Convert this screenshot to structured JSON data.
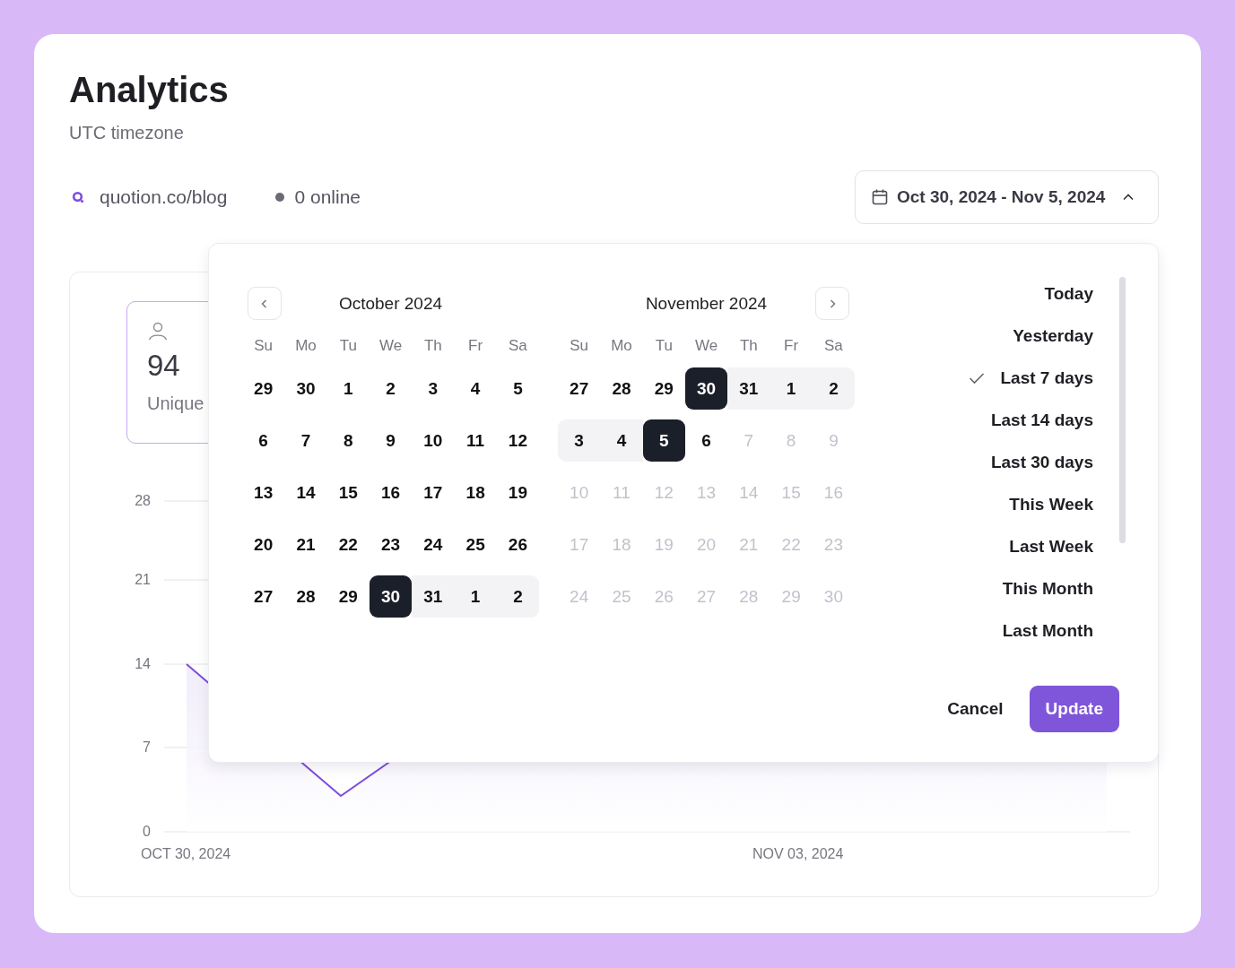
{
  "page": {
    "title": "Analytics",
    "subtitle": "UTC timezone"
  },
  "site": {
    "name": "quotion.co/blog",
    "online": "0 online"
  },
  "date_range": {
    "label": "Oct 30, 2024 - Nov 5, 2024",
    "expanded": true
  },
  "stat_card": {
    "value": "94",
    "label": "Unique"
  },
  "chart": {
    "y_ticks": [
      "28",
      "21",
      "14",
      "7",
      "0"
    ],
    "x_labels": [
      "OCT 30, 2024",
      "NOV 03, 2024"
    ]
  },
  "picker": {
    "months": [
      {
        "title": "October 2024",
        "weekdays": [
          "Su",
          "Mo",
          "Tu",
          "We",
          "Th",
          "Fr",
          "Sa"
        ],
        "weeks": [
          [
            {
              "day": "29",
              "disabled": false,
              "kind": "plain"
            },
            {
              "day": "30",
              "disabled": false,
              "kind": "plain"
            },
            {
              "day": "1",
              "disabled": false,
              "kind": "plain"
            },
            {
              "day": "2",
              "disabled": false,
              "kind": "plain"
            },
            {
              "day": "3",
              "disabled": false,
              "kind": "plain"
            },
            {
              "day": "4",
              "disabled": false,
              "kind": "plain"
            },
            {
              "day": "5",
              "disabled": false,
              "kind": "plain"
            }
          ],
          [
            {
              "day": "6",
              "disabled": false,
              "kind": "plain"
            },
            {
              "day": "7",
              "disabled": false,
              "kind": "plain"
            },
            {
              "day": "8",
              "disabled": false,
              "kind": "plain"
            },
            {
              "day": "9",
              "disabled": false,
              "kind": "plain"
            },
            {
              "day": "10",
              "disabled": false,
              "kind": "plain"
            },
            {
              "day": "11",
              "disabled": false,
              "kind": "plain"
            },
            {
              "day": "12",
              "disabled": false,
              "kind": "plain"
            }
          ],
          [
            {
              "day": "13",
              "disabled": false,
              "kind": "plain"
            },
            {
              "day": "14",
              "disabled": false,
              "kind": "plain"
            },
            {
              "day": "15",
              "disabled": false,
              "kind": "plain"
            },
            {
              "day": "16",
              "disabled": false,
              "kind": "plain"
            },
            {
              "day": "17",
              "disabled": false,
              "kind": "plain"
            },
            {
              "day": "18",
              "disabled": false,
              "kind": "plain"
            },
            {
              "day": "19",
              "disabled": false,
              "kind": "plain"
            }
          ],
          [
            {
              "day": "20",
              "disabled": false,
              "kind": "plain"
            },
            {
              "day": "21",
              "disabled": false,
              "kind": "plain"
            },
            {
              "day": "22",
              "disabled": false,
              "kind": "plain"
            },
            {
              "day": "23",
              "disabled": false,
              "kind": "plain"
            },
            {
              "day": "24",
              "disabled": false,
              "kind": "plain"
            },
            {
              "day": "25",
              "disabled": false,
              "kind": "plain"
            },
            {
              "day": "26",
              "disabled": false,
              "kind": "plain"
            }
          ],
          [
            {
              "day": "27",
              "disabled": false,
              "kind": "plain"
            },
            {
              "day": "28",
              "disabled": false,
              "kind": "plain"
            },
            {
              "day": "29",
              "disabled": false,
              "kind": "plain"
            },
            {
              "day": "30",
              "disabled": false,
              "kind": "endpoint"
            },
            {
              "day": "31",
              "disabled": false,
              "kind": "inside"
            },
            {
              "day": "1",
              "disabled": false,
              "kind": "inside"
            },
            {
              "day": "2",
              "disabled": false,
              "kind": "inside"
            }
          ]
        ]
      },
      {
        "title": "November 2024",
        "weekdays": [
          "Su",
          "Mo",
          "Tu",
          "We",
          "Th",
          "Fr",
          "Sa"
        ],
        "weeks": [
          [
            {
              "day": "27",
              "disabled": false,
              "kind": "plain"
            },
            {
              "day": "28",
              "disabled": false,
              "kind": "plain"
            },
            {
              "day": "29",
              "disabled": false,
              "kind": "plain"
            },
            {
              "day": "30",
              "disabled": false,
              "kind": "endpoint"
            },
            {
              "day": "31",
              "disabled": false,
              "kind": "inside"
            },
            {
              "day": "1",
              "disabled": false,
              "kind": "inside"
            },
            {
              "day": "2",
              "disabled": false,
              "kind": "inside"
            }
          ],
          [
            {
              "day": "3",
              "disabled": false,
              "kind": "inside"
            },
            {
              "day": "4",
              "disabled": false,
              "kind": "inside"
            },
            {
              "day": "5",
              "disabled": false,
              "kind": "endpoint"
            },
            {
              "day": "6",
              "disabled": false,
              "kind": "plain"
            },
            {
              "day": "7",
              "disabled": true,
              "kind": "plain"
            },
            {
              "day": "8",
              "disabled": true,
              "kind": "plain"
            },
            {
              "day": "9",
              "disabled": true,
              "kind": "plain"
            }
          ],
          [
            {
              "day": "10",
              "disabled": true,
              "kind": "plain"
            },
            {
              "day": "11",
              "disabled": true,
              "kind": "plain"
            },
            {
              "day": "12",
              "disabled": true,
              "kind": "plain"
            },
            {
              "day": "13",
              "disabled": true,
              "kind": "plain"
            },
            {
              "day": "14",
              "disabled": true,
              "kind": "plain"
            },
            {
              "day": "15",
              "disabled": true,
              "kind": "plain"
            },
            {
              "day": "16",
              "disabled": true,
              "kind": "plain"
            }
          ],
          [
            {
              "day": "17",
              "disabled": true,
              "kind": "plain"
            },
            {
              "day": "18",
              "disabled": true,
              "kind": "plain"
            },
            {
              "day": "19",
              "disabled": true,
              "kind": "plain"
            },
            {
              "day": "20",
              "disabled": true,
              "kind": "plain"
            },
            {
              "day": "21",
              "disabled": true,
              "kind": "plain"
            },
            {
              "day": "22",
              "disabled": true,
              "kind": "plain"
            },
            {
              "day": "23",
              "disabled": true,
              "kind": "plain"
            }
          ],
          [
            {
              "day": "24",
              "disabled": true,
              "kind": "plain"
            },
            {
              "day": "25",
              "disabled": true,
              "kind": "plain"
            },
            {
              "day": "26",
              "disabled": true,
              "kind": "plain"
            },
            {
              "day": "27",
              "disabled": true,
              "kind": "plain"
            },
            {
              "day": "28",
              "disabled": true,
              "kind": "plain"
            },
            {
              "day": "29",
              "disabled": true,
              "kind": "plain"
            },
            {
              "day": "30",
              "disabled": true,
              "kind": "plain"
            }
          ]
        ]
      }
    ],
    "presets": [
      {
        "label": "Today",
        "selected": false
      },
      {
        "label": "Yesterday",
        "selected": false
      },
      {
        "label": "Last 7 days",
        "selected": true
      },
      {
        "label": "Last 14 days",
        "selected": false
      },
      {
        "label": "Last 30 days",
        "selected": false
      },
      {
        "label": "This Week",
        "selected": false
      },
      {
        "label": "Last Week",
        "selected": false
      },
      {
        "label": "This Month",
        "selected": false
      },
      {
        "label": "Last Month",
        "selected": false
      }
    ],
    "cancel": "Cancel",
    "update": "Update"
  }
}
